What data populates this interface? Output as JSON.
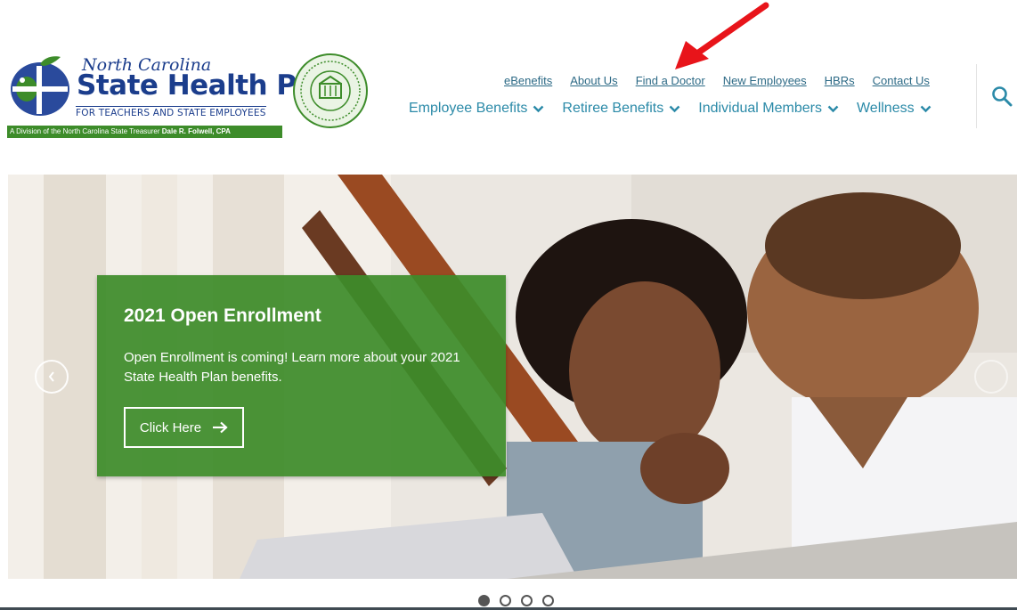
{
  "logo": {
    "script_line": "North Carolina",
    "name": "State Health Plan",
    "subtitle": "FOR TEACHERS AND STATE EMPLOYEES",
    "division_prefix": "A Division of the North Carolina State Treasurer ",
    "division_name": "Dale R. Folwell, CPA"
  },
  "utility_nav": [
    "eBenefits",
    "About Us",
    "Find a Doctor",
    "New Employees",
    "HBRs",
    "Contact Us"
  ],
  "main_nav": [
    "Employee Benefits",
    "Retiree Benefits",
    "Individual Members",
    "Wellness"
  ],
  "hero": {
    "title": "2021 Open Enrollment",
    "body": "Open Enrollment is coming! Learn more about your 2021 State Health Plan benefits.",
    "cta": "Click Here"
  },
  "carousel": {
    "slide_count": 4,
    "active_slide": 1
  },
  "icons": {
    "search": "search-icon",
    "cta_arrow": "arrow-right-icon",
    "prev": "chevron-left-icon",
    "nav_chevron": "chevron-down-icon",
    "annotation": "red-arrow-icon"
  },
  "colors": {
    "brand_blue": "#1b3d8c",
    "brand_green": "#3d8c2a",
    "nav_link": "#2b8aa8",
    "annotation_red": "#e8141a"
  }
}
